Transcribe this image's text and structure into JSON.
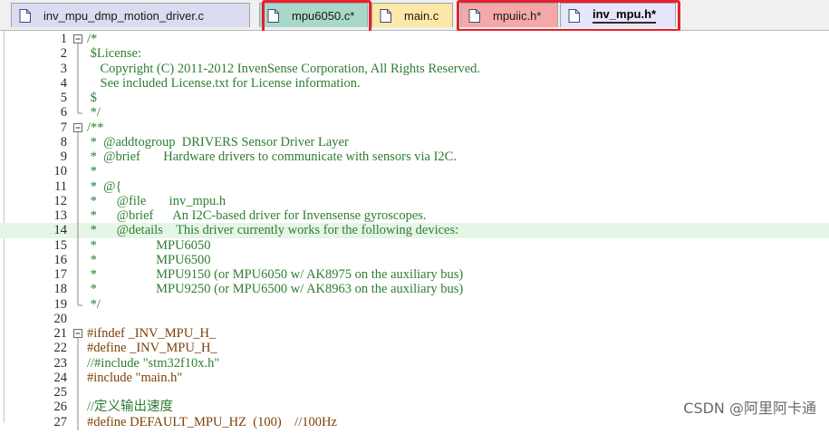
{
  "tabs": [
    {
      "label": "inv_mpu_dmp_motion_driver.c",
      "color": "#dcdcf0"
    },
    {
      "label": "mpu6050.c*",
      "color": "#a8d8c8"
    },
    {
      "label": "main.c",
      "color": "#fde8a8"
    },
    {
      "label": "mpuiic.h*",
      "color": "#f4a8a8"
    },
    {
      "label": "inv_mpu.h*",
      "color": "#e6e6fa",
      "active": true
    }
  ],
  "editor": {
    "lines": [
      {
        "n": "1",
        "text": "/*",
        "cls": "c-comment",
        "fold": "open"
      },
      {
        "n": "2",
        "text": " $License:",
        "cls": "c-comment",
        "fold": "bar"
      },
      {
        "n": "3",
        "text": "    Copyright (C) 2011-2012 InvenSense Corporation, All Rights Reserved.",
        "cls": "c-comment",
        "fold": "bar"
      },
      {
        "n": "4",
        "text": "    See included License.txt for License information.",
        "cls": "c-comment",
        "fold": "bar"
      },
      {
        "n": "5",
        "text": " $",
        "cls": "c-comment",
        "fold": "bar"
      },
      {
        "n": "6",
        "text": " */",
        "cls": "c-comment",
        "fold": "end"
      },
      {
        "n": "7",
        "text": "/**",
        "cls": "c-comment",
        "fold": "open"
      },
      {
        "n": "8",
        "text": " *  @addtogroup  DRIVERS Sensor Driver Layer",
        "cls": "c-comment",
        "fold": "bar"
      },
      {
        "n": "9",
        "text": " *  @brief       Hardware drivers to communicate with sensors via I2C.",
        "cls": "c-comment",
        "fold": "bar"
      },
      {
        "n": "10",
        "text": " *",
        "cls": "c-comment",
        "fold": "bar"
      },
      {
        "n": "11",
        "text": " *  @{",
        "cls": "c-comment",
        "fold": "bar"
      },
      {
        "n": "12",
        "text": " *      @file       inv_mpu.h",
        "cls": "c-comment",
        "fold": "bar"
      },
      {
        "n": "13",
        "text": " *      @brief      An I2C-based driver for Invensense gyroscopes.",
        "cls": "c-comment",
        "fold": "bar"
      },
      {
        "n": "14",
        "text": " *      @details    This driver currently works for the following devices:",
        "cls": "c-comment",
        "fold": "bar",
        "current": true
      },
      {
        "n": "15",
        "text": " *                  MPU6050",
        "cls": "c-comment",
        "fold": "bar"
      },
      {
        "n": "16",
        "text": " *                  MPU6500",
        "cls": "c-comment",
        "fold": "bar"
      },
      {
        "n": "17",
        "text": " *                  MPU9150 (or MPU6050 w/ AK8975 on the auxiliary bus)",
        "cls": "c-comment",
        "fold": "bar"
      },
      {
        "n": "18",
        "text": " *                  MPU9250 (or MPU6500 w/ AK8963 on the auxiliary bus)",
        "cls": "c-comment",
        "fold": "bar"
      },
      {
        "n": "19",
        "text": " */",
        "cls": "c-comment",
        "fold": "end"
      },
      {
        "n": "20",
        "text": "",
        "cls": "c-text",
        "fold": "none"
      },
      {
        "n": "21",
        "text": "#ifndef _INV_MPU_H_",
        "cls": "c-prep",
        "fold": "open"
      },
      {
        "n": "22",
        "text": "#define _INV_MPU_H_",
        "cls": "c-prep",
        "fold": "bar"
      },
      {
        "n": "23",
        "text": "//#include \"stm32f10x.h\"",
        "cls": "c-comment",
        "fold": "bar"
      },
      {
        "n": "24",
        "text": "#include \"main.h\"",
        "cls": "c-prep",
        "fold": "bar"
      },
      {
        "n": "25",
        "text": "",
        "cls": "c-text",
        "fold": "bar"
      },
      {
        "n": "26",
        "text": "//定义输出速度",
        "cls": "c-comment",
        "fold": "bar"
      },
      {
        "n": "27",
        "text": "#define DEFAULT_MPU_HZ  (100)    //100Hz",
        "cls": "c-prep",
        "fold": "bar"
      }
    ]
  },
  "watermark": "CSDN @阿里阿卡通",
  "highlight_color": "#e8202a"
}
